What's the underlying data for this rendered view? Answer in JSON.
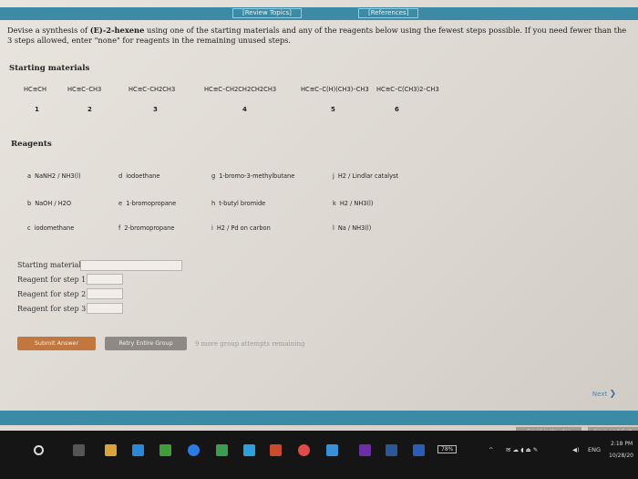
{
  "top_links": {
    "review_topics": "[Review Topics]",
    "references": "[References]"
  },
  "instructions": "Devise a synthesis of (E)-2-hexene using one of the starting materials and any of the reagents below using the fewest steps possible. If you need fewer than the 3 steps allowed, enter \"none\" for reagents in the remaining unused steps.",
  "instructions_bold": "(E)-2-hexene",
  "starting_materials": {
    "heading": "Starting materials",
    "items": [
      {
        "formula": "HC≡CH",
        "number": "1"
      },
      {
        "formula": "HC≡C–CH3",
        "number": "2"
      },
      {
        "formula": "HC≡C–CH2CH3",
        "number": "3"
      },
      {
        "formula": "HC≡C–CH2CH2CH2CH3",
        "number": "4"
      },
      {
        "formula": "HC≡C–C(H)(CH3)–CH3",
        "number": "5"
      },
      {
        "formula": "HC≡C–C(CH3)2–CH3",
        "number": "6"
      }
    ]
  },
  "reagents": {
    "heading": "Reagents",
    "items": [
      {
        "letter": "a",
        "name": "NaNH2 / NH3(l)"
      },
      {
        "letter": "b",
        "name": "NaOH / H2O"
      },
      {
        "letter": "c",
        "name": "iodomethane"
      },
      {
        "letter": "d",
        "name": "iodoethane"
      },
      {
        "letter": "e",
        "name": "1-bromopropane"
      },
      {
        "letter": "f",
        "name": "2-bromopropane"
      },
      {
        "letter": "g",
        "name": "1-bromo-3-methylbutane"
      },
      {
        "letter": "h",
        "name": "t-butyl bromide"
      },
      {
        "letter": "i",
        "name": "H2 / Pd on carbon"
      },
      {
        "letter": "j",
        "name": "H2 / Lindlar catalyst"
      },
      {
        "letter": "k",
        "name": "H2 / NH3(l)"
      },
      {
        "letter": "l",
        "name": "Na / NH3(l)"
      }
    ]
  },
  "form": {
    "starting_material_label": "Starting material",
    "step1_label": "Reagent for step 1",
    "step2_label": "Reagent for step 2",
    "step3_label": "Reagent for step 3",
    "starting_material_value": "",
    "step1_value": "",
    "step2_value": "",
    "step3_value": ""
  },
  "buttons": {
    "submit": "Submit Answer",
    "retry": "Retry Entire Group",
    "attempts": "9 more group attempts remaining"
  },
  "nav": {
    "next": "Next"
  },
  "footer": {
    "email": "Email Instructor",
    "save": "Save and Exit"
  },
  "taskbar": {
    "battery": "78%",
    "language": "ENG",
    "time": "2:18 PM",
    "date": "10/28/20"
  },
  "colors": {
    "header_bar": "#3c8aa5",
    "submit_button": "#c2773f",
    "retry_button": "#8d8a86",
    "taskbar": "#151515"
  }
}
